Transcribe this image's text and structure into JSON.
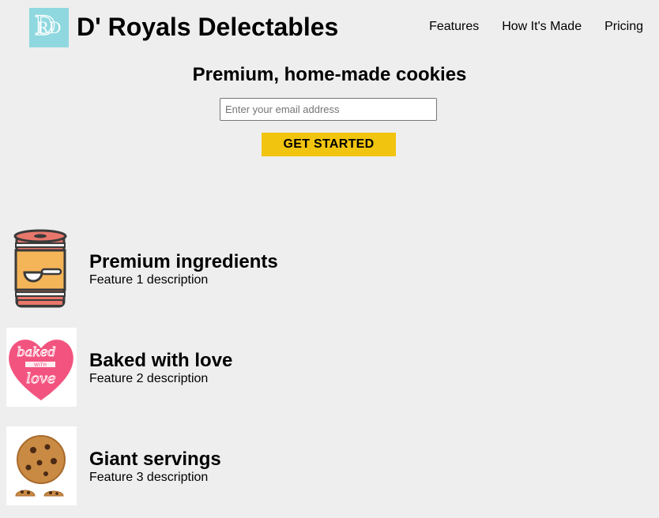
{
  "header": {
    "logo_letters": "DRD",
    "brand": "D' Royals Delectables",
    "nav": [
      "Features",
      "How It's Made",
      "Pricing"
    ]
  },
  "hero": {
    "title": "Premium, home-made cookies",
    "email_placeholder": "Enter your email address",
    "submit_label": "GET STARTED"
  },
  "features": [
    {
      "title": "Premium ingredients",
      "description": "Feature 1 description",
      "icon": "ingredient-can-icon"
    },
    {
      "title": "Baked with love",
      "description": "Feature 2 description",
      "icon": "baked-with-love-heart-icon"
    },
    {
      "title": "Giant servings",
      "description": "Feature 3 description",
      "icon": "cookie-icon"
    }
  ],
  "colors": {
    "background": "#eeeeee",
    "logo_bg": "#8fd8df",
    "button": "#f1c40f",
    "heart": "#f2547f",
    "can_body": "#f4b458",
    "can_red": "#e8776b"
  }
}
